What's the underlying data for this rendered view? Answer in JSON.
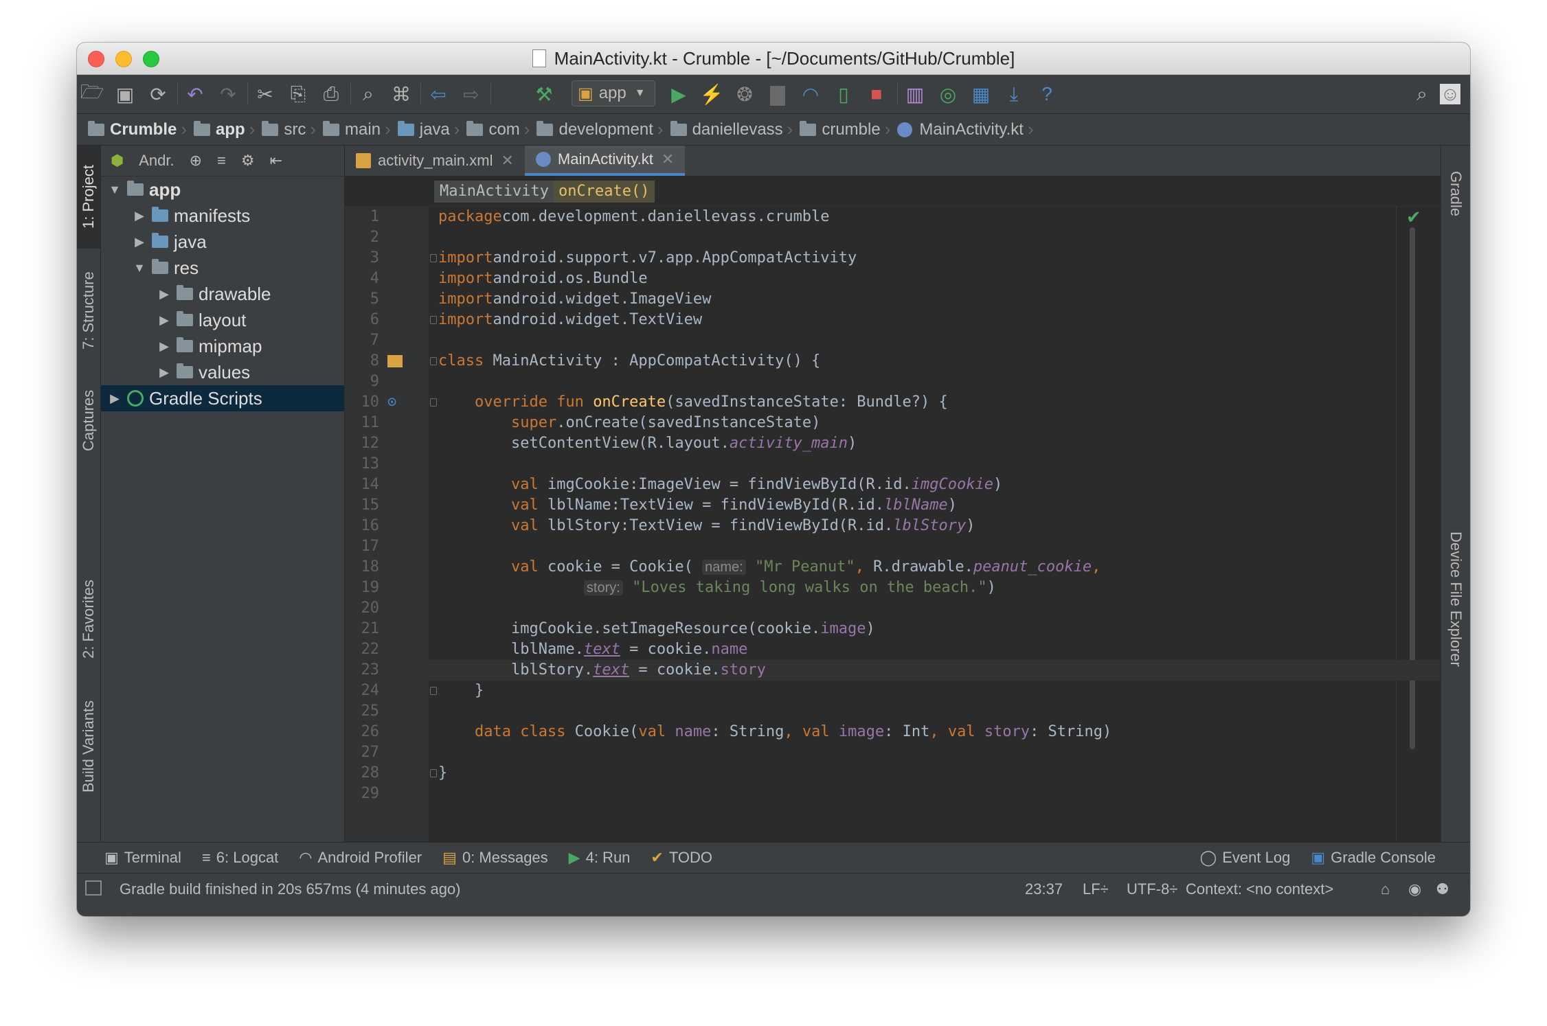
{
  "window": {
    "title": "MainActivity.kt - Crumble - [~/Documents/GitHub/Crumble]"
  },
  "toolbar": {
    "run_config": "app",
    "icons": [
      "open-folder-icon",
      "save-icon",
      "sync-icon",
      "undo-icon",
      "redo-icon",
      "cut-icon",
      "copy-icon",
      "paste-icon",
      "find-icon",
      "replace-icon",
      "back-icon",
      "forward-icon",
      "make-project-icon",
      "run-icon",
      "apply-changes-icon",
      "debug-icon",
      "attach-debugger-icon",
      "profile-icon",
      "device-icon",
      "stop-icon",
      "avd-manager-icon",
      "gradle-sync-icon",
      "project-structure-icon",
      "sdk-manager-icon",
      "help-icon",
      "search-everywhere-icon",
      "user-icon"
    ]
  },
  "breadcrumbs": [
    "Crumble",
    "app",
    "src",
    "main",
    "java",
    "com",
    "development",
    "daniellevass",
    "crumble",
    "MainActivity.kt"
  ],
  "left_tabs": [
    "1: Project",
    "7: Structure",
    "Captures",
    "2: Favorites",
    "Build Variants"
  ],
  "right_tabs": [
    "Gradle",
    "Device File Explorer"
  ],
  "project": {
    "view": "Andr.",
    "tree": [
      {
        "label": "app",
        "level": 0,
        "arrow": "▼",
        "icon": "module-folder-icon"
      },
      {
        "label": "manifests",
        "level": 1,
        "arrow": "▶",
        "icon": "folder-icon"
      },
      {
        "label": "java",
        "level": 1,
        "arrow": "▶",
        "icon": "folder-icon"
      },
      {
        "label": "res",
        "level": 1,
        "arrow": "▼",
        "icon": "res-folder-icon"
      },
      {
        "label": "drawable",
        "level": 2,
        "arrow": "▶",
        "icon": "folder-icon"
      },
      {
        "label": "layout",
        "level": 2,
        "arrow": "▶",
        "icon": "folder-icon"
      },
      {
        "label": "mipmap",
        "level": 2,
        "arrow": "▶",
        "icon": "folder-icon"
      },
      {
        "label": "values",
        "level": 2,
        "arrow": "▶",
        "icon": "folder-icon"
      },
      {
        "label": "Gradle Scripts",
        "level": 0,
        "arrow": "▶",
        "icon": "gradle-icon",
        "selected": true
      }
    ]
  },
  "editor": {
    "tabs": [
      {
        "label": "activity_main.xml",
        "active": false
      },
      {
        "label": "MainActivity.kt",
        "active": true
      }
    ],
    "breadcrumb_class": "MainActivity",
    "breadcrumb_method": "onCreate()",
    "current_line": 23,
    "lines": [
      [
        [
          "k",
          "package"
        ],
        [
          "",
          "com.development.daniellevass.crumble"
        ]
      ],
      [],
      [
        [
          "k",
          "import"
        ],
        [
          "",
          "android.support.v7.app.AppCompatActivity"
        ]
      ],
      [
        [
          "k",
          "import"
        ],
        [
          "",
          "android.os.Bundle"
        ]
      ],
      [
        [
          "k",
          "import"
        ],
        [
          "",
          "android.widget.ImageView"
        ]
      ],
      [
        [
          "k",
          "import"
        ],
        [
          "",
          "android.widget.TextView"
        ]
      ],
      [],
      [
        [
          "k",
          "class"
        ],
        [
          "",
          " MainActivity : AppCompatActivity() {"
        ]
      ],
      [],
      [
        [
          "",
          "    "
        ],
        [
          "k",
          "override fun"
        ],
        [
          "",
          " "
        ],
        [
          "fn",
          "onCreate"
        ],
        [
          "",
          "(savedInstanceState: Bundle?) {"
        ]
      ],
      [
        [
          "",
          "        "
        ],
        [
          "k",
          "super"
        ],
        [
          "",
          ".onCreate(savedInstanceState)"
        ]
      ],
      [
        [
          "",
          "        setContentView(R.layout."
        ],
        [
          "pi",
          "activity_main"
        ],
        [
          "",
          ")"
        ]
      ],
      [],
      [
        [
          "",
          "        "
        ],
        [
          "k",
          "val"
        ],
        [
          "",
          " imgCookie:ImageView = findViewById(R.id."
        ],
        [
          "pi",
          "imgCookie"
        ],
        [
          "",
          ")"
        ]
      ],
      [
        [
          "",
          "        "
        ],
        [
          "k",
          "val"
        ],
        [
          "",
          " lblName:TextView = findViewById(R.id."
        ],
        [
          "pi",
          "lblName"
        ],
        [
          "",
          ")"
        ]
      ],
      [
        [
          "",
          "        "
        ],
        [
          "k",
          "val"
        ],
        [
          "",
          " lblStory:TextView = findViewById(R.id."
        ],
        [
          "pi",
          "lblStory"
        ],
        [
          "",
          ")"
        ]
      ],
      [],
      [
        [
          "",
          "        "
        ],
        [
          "k",
          "val"
        ],
        [
          "",
          " cookie = Cookie( "
        ],
        [
          "hint",
          "name:"
        ],
        [
          "",
          ""
        ],
        [
          "s",
          " \"Mr Peanut\""
        ],
        [
          "k",
          ","
        ],
        [
          "",
          " R.drawable."
        ],
        [
          "pi",
          "peanut_cookie"
        ],
        [
          "k",
          ","
        ]
      ],
      [
        [
          "",
          "                "
        ],
        [
          "hint",
          "story:"
        ],
        [
          "s",
          " \"Loves taking long walks on the beach.\""
        ],
        [
          "",
          ")"
        ]
      ],
      [],
      [
        [
          "",
          "        imgCookie.setImageResource(cookie."
        ],
        [
          "p",
          "image"
        ],
        [
          "",
          ")"
        ]
      ],
      [
        [
          "",
          "        lblName."
        ],
        [
          "pu",
          "text"
        ],
        [
          "",
          " = cookie."
        ],
        [
          "p",
          "name"
        ]
      ],
      [
        [
          "",
          "        lblStory."
        ],
        [
          "pu",
          "text"
        ],
        [
          "",
          " = cookie."
        ],
        [
          "p",
          "story"
        ]
      ],
      [
        [
          "",
          "    }"
        ]
      ],
      [],
      [
        [
          "",
          "    "
        ],
        [
          "k",
          "data class"
        ],
        [
          "",
          " Cookie("
        ],
        [
          "k",
          "val"
        ],
        [
          "",
          " "
        ],
        [
          "p",
          "name"
        ],
        [
          "",
          ": String"
        ],
        [
          "k",
          ","
        ],
        [
          "",
          " "
        ],
        [
          "k",
          "val"
        ],
        [
          "",
          " "
        ],
        [
          "p",
          "image"
        ],
        [
          "",
          ": Int"
        ],
        [
          "k",
          ","
        ],
        [
          "",
          " "
        ],
        [
          "k",
          "val"
        ],
        [
          "",
          " "
        ],
        [
          "p",
          "story"
        ],
        [
          "",
          ": String)"
        ]
      ],
      [],
      [
        [
          "",
          "}"
        ]
      ],
      []
    ]
  },
  "bottom_tabs": [
    {
      "label": "Terminal",
      "icon": "terminal-icon"
    },
    {
      "label": "6: Logcat",
      "icon": "logcat-icon"
    },
    {
      "label": "Android Profiler",
      "icon": "profiler-icon"
    },
    {
      "label": "0: Messages",
      "icon": "messages-icon"
    },
    {
      "label": "4: Run",
      "icon": "run-icon"
    },
    {
      "label": "TODO",
      "icon": "todo-icon"
    },
    {
      "label": "Event Log",
      "icon": "event-log-icon"
    },
    {
      "label": "Gradle Console",
      "icon": "gradle-console-icon"
    }
  ],
  "status": {
    "message": "Gradle build finished in 20s 657ms (4 minutes ago)",
    "position": "23:37",
    "line_separator": "LF÷",
    "encoding": "UTF-8÷",
    "context": "Context: <no context>"
  },
  "colors": {
    "editor_bg": "#2b2b2b",
    "panel_bg": "#3c3f41",
    "keyword": "#cc7832",
    "function": "#ffc66d",
    "string": "#6a8759",
    "property": "#9876aa",
    "text": "#a9b7c6",
    "selection": "#0d293e",
    "accent": "#4a88c7"
  }
}
